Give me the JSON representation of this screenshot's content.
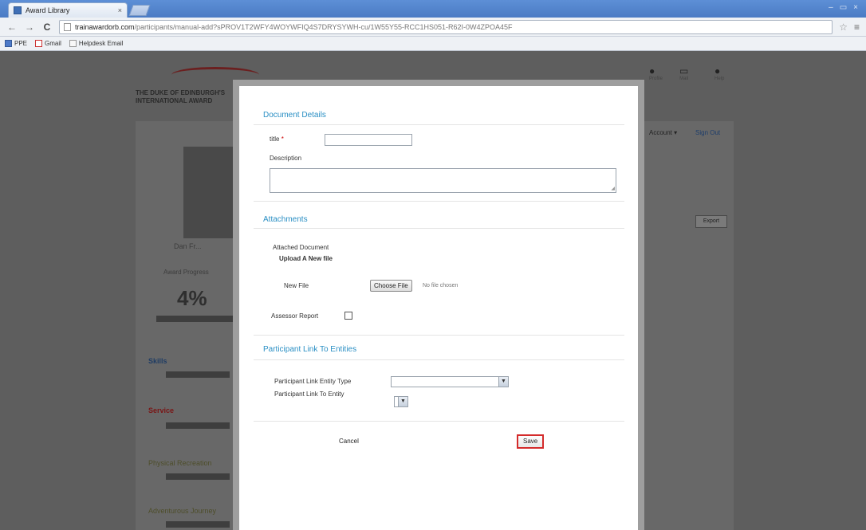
{
  "browser": {
    "tab_title": "Award Library",
    "tab_close": "×",
    "window_controls": [
      "–",
      "▭",
      "×"
    ],
    "nav": {
      "back": "←",
      "forward": "→",
      "reload": "C"
    },
    "url_host": "trainawardorb.com",
    "url_rest": "/participants/manual-add?sPROV1T2WFY4WOYWFIQ4S7DRYSYWH-cu/1W55Y55-RCC1HS051-R62I-0W4ZPOA45F",
    "star": "☆",
    "menu": "≡",
    "bookmarks": [
      {
        "label": "PPE",
        "icon": "blue"
      },
      {
        "label": "Gmail",
        "icon": "red"
      },
      {
        "label": "Helpdesk Email",
        "icon": "plain"
      }
    ]
  },
  "background_page": {
    "logo_line1": "THE DUKE OF EDINBURGH'S",
    "logo_line2": "INTERNATIONAL AWARD",
    "top_icons": [
      {
        "glyph": "●",
        "label": "Profile"
      },
      {
        "glyph": "▭",
        "label": "Mail"
      },
      {
        "glyph": "●",
        "label": "Help"
      }
    ],
    "account_dropdown": "Account ▾",
    "sign_out": "Sign Out",
    "name": "Dan Fr...",
    "progress_label": "Award Progress",
    "progress_value": "4%",
    "export_button": "Export",
    "side_items": [
      {
        "label": "Skills",
        "style": "blue"
      },
      {
        "label": "Service",
        "style": "red"
      },
      {
        "label": "Physical Recreation",
        "style": "olive"
      },
      {
        "label": "Adventurous Journey",
        "style": "olive"
      }
    ]
  },
  "modal": {
    "document_details_title": "Document Details",
    "title_label": "title",
    "title_required": "*",
    "title_value": "",
    "description_label": "Description",
    "description_value": "",
    "attachments_title": "Attachments",
    "attached_document_label": "Attached Document",
    "upload_new_file_label": "Upload A New file",
    "new_file_label": "New File",
    "choose_file_button": "Choose File",
    "no_file_chosen": "No file chosen",
    "assessor_report_label": "Assessor Report",
    "assessor_report_checked": false,
    "participant_link_title": "Participant Link To Entities",
    "entity_type_label": "Participant Link Entity Type",
    "entity_type_value": "",
    "link_to_entity_label": "Participant Link To Entity",
    "link_to_entity_value": "",
    "cancel_button": "Cancel",
    "save_button": "Save"
  },
  "colors": {
    "section_title": "#2a8fc4",
    "save_highlight": "#d42b2b",
    "overlay": "#5e5e5e"
  }
}
